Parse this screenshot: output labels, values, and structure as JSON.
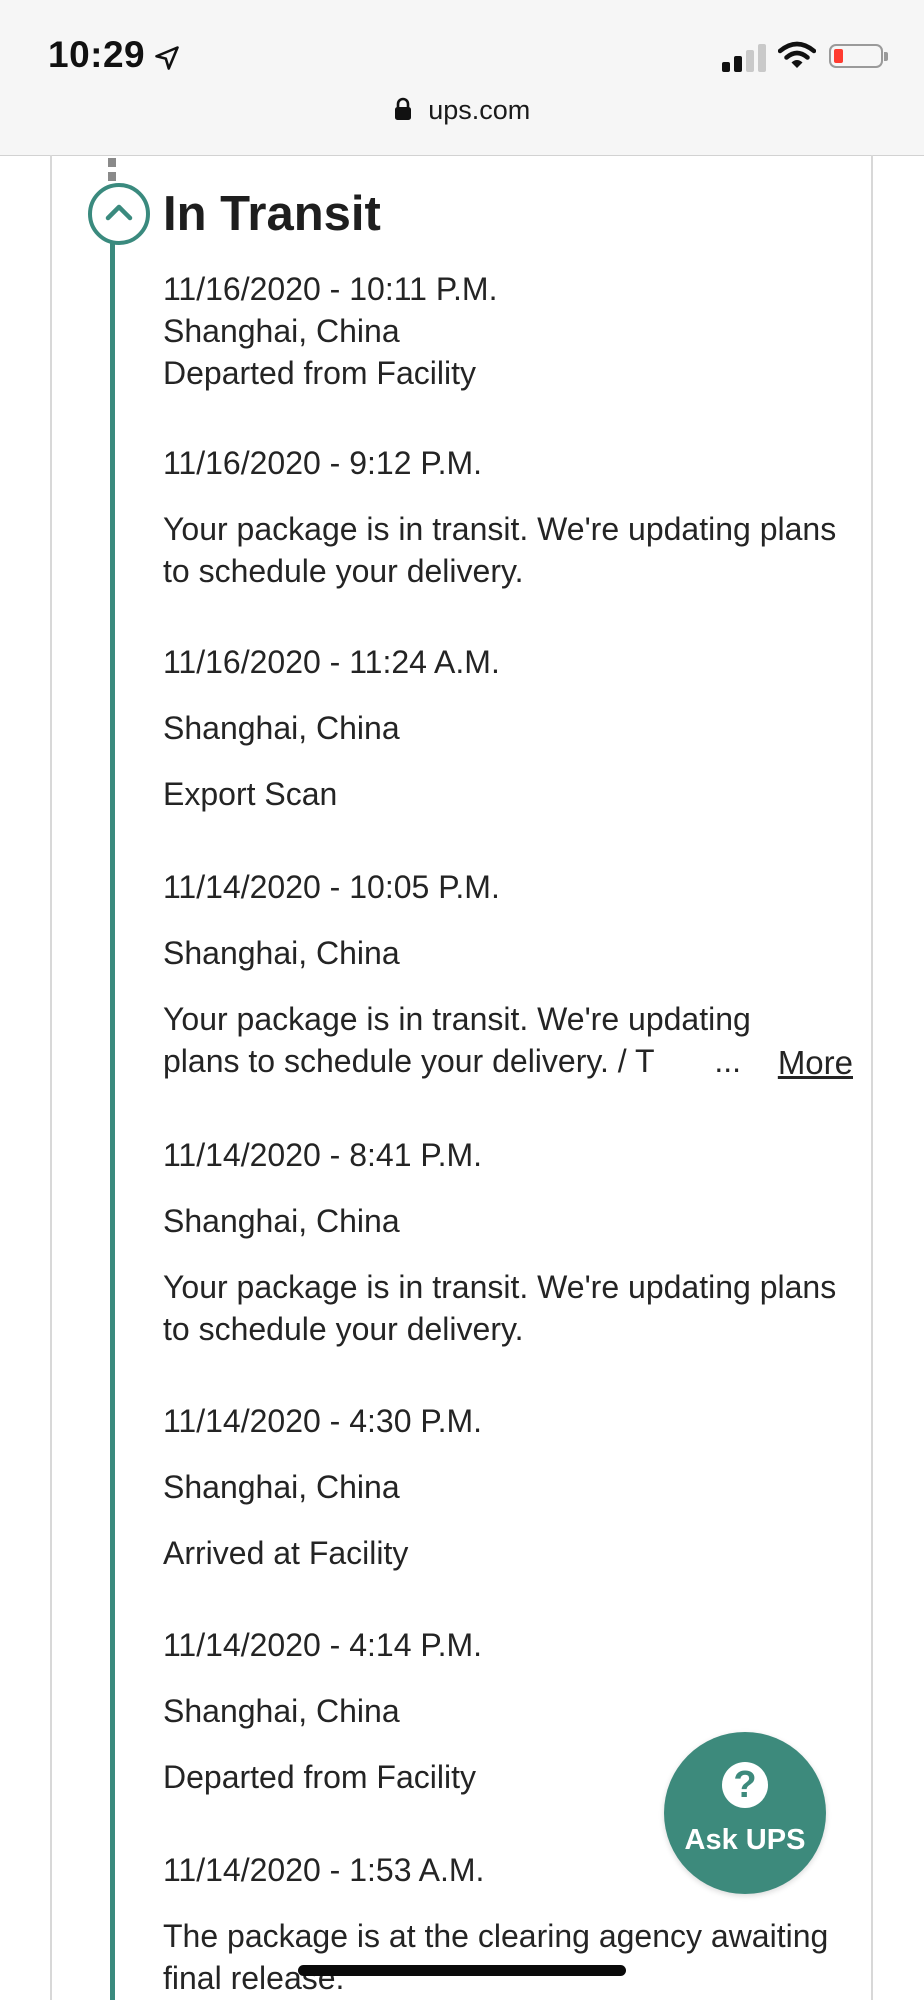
{
  "status_bar": {
    "time": "10:29",
    "location_icon": "location-arrow-icon",
    "signal_icon": "cellular-signal-icon",
    "wifi_icon": "wifi-icon",
    "battery_icon": "battery-low-icon",
    "battery_color": "#ff3b30"
  },
  "browser": {
    "domain": "ups.com",
    "lock_icon": "lock-icon"
  },
  "colors": {
    "accent": "#3a8a7e",
    "text": "#242424"
  },
  "tracking": {
    "section_title": "In Transit",
    "collapse_icon": "chevron-up-icon",
    "activities": [
      {
        "datetime": "11/16/2020 - 10:11 P.M.",
        "location": "Shanghai, China",
        "status": "Departed from Facility"
      },
      {
        "datetime": "11/16/2020 - 9:12 P.M.",
        "status": "Your package is in transit. We're updating plans to schedule your delivery."
      },
      {
        "datetime": "11/16/2020 - 11:24 A.M.",
        "location": "Shanghai, China",
        "status": "Export Scan"
      },
      {
        "datetime": "11/14/2020 - 10:05 P.M.",
        "location": "Shanghai, China",
        "status_line1": "Your package is in transit. We're updating",
        "status_line2": "plans to schedule your delivery. / T",
        "ellipsis": "...",
        "more_label": "More"
      },
      {
        "datetime": "11/14/2020 - 8:41 P.M.",
        "location": "Shanghai, China",
        "status": "Your package is in transit. We're updating plans to schedule your delivery."
      },
      {
        "datetime": "11/14/2020 - 4:30 P.M.",
        "location": "Shanghai, China",
        "status": "Arrived at Facility"
      },
      {
        "datetime": "11/14/2020 - 4:14 P.M.",
        "location": "Shanghai, China",
        "status": "Departed from Facility"
      },
      {
        "datetime": "11/14/2020 - 1:53 A.M.",
        "status": "The package is at the clearing agency awaiting final release."
      }
    ]
  },
  "ask_ups": {
    "icon": "question-circle-icon",
    "icon_glyph": "?",
    "label": "Ask UPS",
    "color": "#3d8a7c"
  }
}
